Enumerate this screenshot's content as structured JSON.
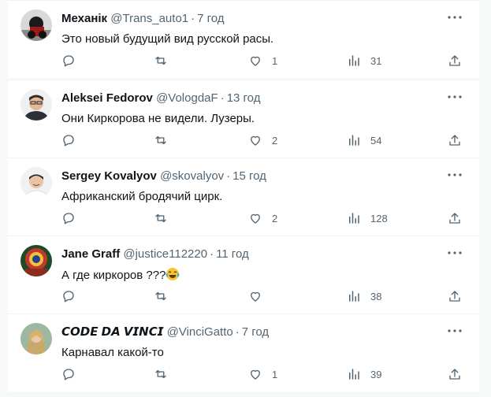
{
  "replies": [
    {
      "name": "Механік",
      "handle": "@Trans_auto1",
      "dot": "·",
      "age": "7 год",
      "text": "Это новый будущий вид русской расы.",
      "reply_count": "",
      "repost_count": "",
      "like_count": "1",
      "view_count": "31"
    },
    {
      "name": "Aleksei Fedorov",
      "handle": "@VologdaF",
      "dot": "·",
      "age": "13 год",
      "text": "Они Киркорова не видели. Лузеры.",
      "reply_count": "",
      "repost_count": "",
      "like_count": "2",
      "view_count": "54"
    },
    {
      "name": "Sergey Kovalyov",
      "handle": "@skovalyov",
      "dot": "·",
      "age": "15 год",
      "text": "Африканский бродячий цирк.",
      "reply_count": "",
      "repost_count": "",
      "like_count": "2",
      "view_count": "128"
    },
    {
      "name": "Jane Graff",
      "handle": "@justice112220",
      "dot": "·",
      "age": "11 год",
      "text": "А где киркоров ???",
      "emoji": "face-with-tears-of-joy",
      "reply_count": "",
      "repost_count": "",
      "like_count": "",
      "view_count": "38"
    },
    {
      "name": "𝘾𝙊𝘿𝙀 𝘿𝘼 𝙑𝙄𝙉𝘾𝙄",
      "handle": "@VinciGatto",
      "dot": "·",
      "age": "7 год",
      "text": "Карнавал какой-то",
      "reply_count": "",
      "repost_count": "",
      "like_count": "1",
      "view_count": "39"
    }
  ],
  "icons": {
    "reply": "reply-icon",
    "repost": "repost-icon",
    "like": "like-icon",
    "views": "views-icon",
    "share": "share-icon",
    "more": "more-icon"
  },
  "colors": {
    "text": "#0f1419",
    "muted": "#536471",
    "background": "#f7f9f9"
  }
}
